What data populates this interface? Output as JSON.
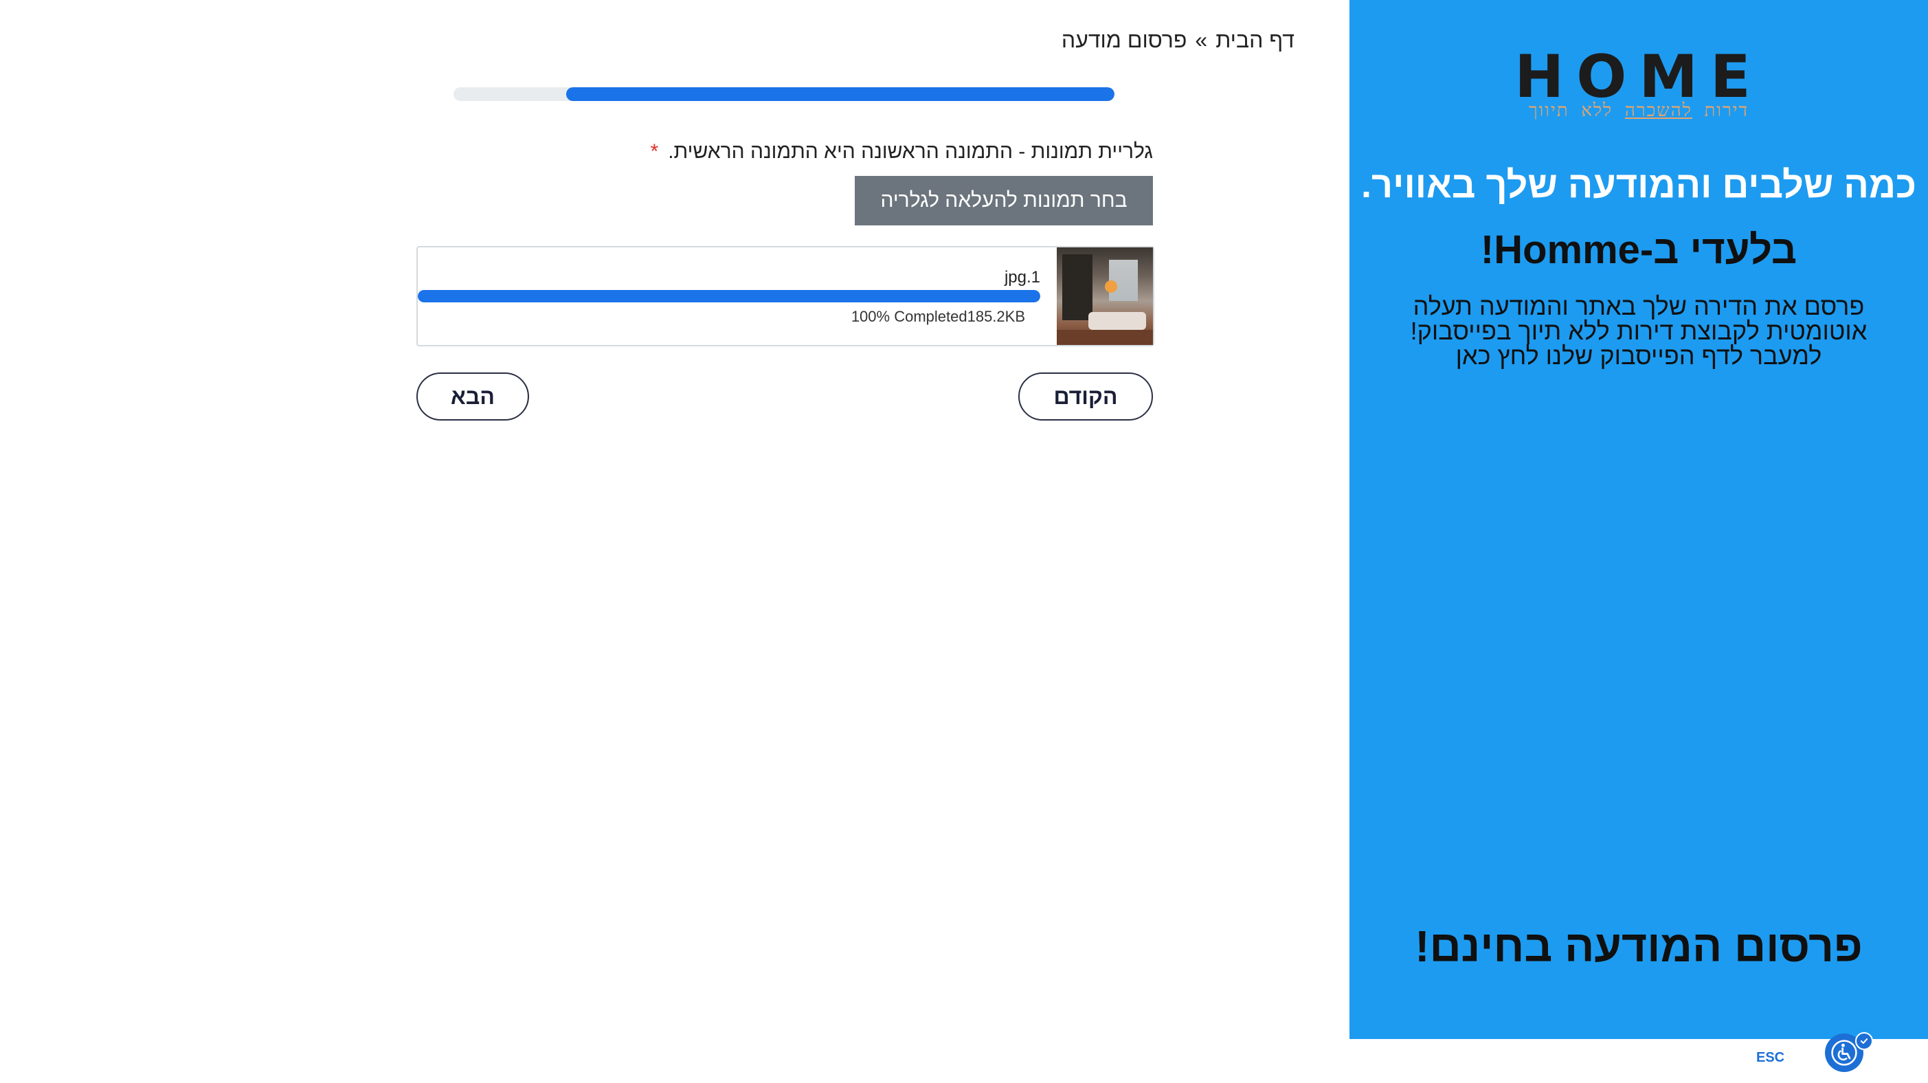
{
  "breadcrumb": {
    "home": "דף הבית",
    "separator": "»",
    "current": "פרסום מודעה"
  },
  "form_progress": {
    "percent": 83
  },
  "gallery": {
    "label": "גלריית תמונות - התמונה הראשונה היא התמונה הראשית.",
    "required_mark": "*",
    "choose_button": "בחר תמונות להעלאה לגלריה"
  },
  "upload": {
    "file_name": "jpg.1",
    "percent": 100,
    "status": "100% Completed",
    "size": "185.2KB"
  },
  "nav": {
    "prev_label": "הקודם",
    "next_label": "הבא"
  },
  "side": {
    "logo": "HOME",
    "logo_sub_a": "דירות",
    "logo_sub_b": "להשכרה",
    "logo_sub_c": "ללא תיווך",
    "promo_title": "כמה שלבים והמודעה שלך באוויר.",
    "promo_subtitle": "בלעדי ב-Homme!",
    "promo_line1": "פרסם את הדירה שלך באתר והמודעה תעלה",
    "promo_line2": "אוטומטית לקבוצת דירות ללא תיוך בפייסבוק!",
    "promo_line3": "למעבר לדף הפייסבוק שלנו לחץ כאן",
    "promo_bottom": "פרסום המודעה בחינם!"
  },
  "accessibility": {
    "esc_label": "ESC",
    "icon": "wheelchair-icon"
  },
  "colors": {
    "accent": "#1a73e8",
    "panel": "#1d9bf0",
    "logo_sub": "#e8a46a",
    "button_gray": "#6c757d",
    "required": "#e0302a"
  }
}
